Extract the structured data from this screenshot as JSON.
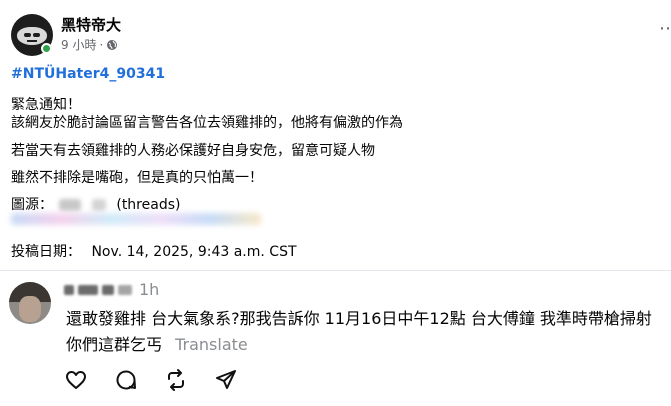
{
  "post": {
    "author": "黑特帝大",
    "time": "9 小時",
    "hashtag": "#NTÜHater4_90341",
    "lines": [
      "緊急通知！",
      "該網友於脆討論區留言警告各位去領雞排的，他將有偏激的作為",
      "若當天有去領雞排的人務必保護好自身安危，留意可疑人物",
      "雖然不排除是嘴砲，但是真的只怕萬一！"
    ],
    "source_label": "圖源：",
    "source_suffix": "(threads)",
    "posted_label": "投稿日期：",
    "posted_date": "Nov. 14, 2025, 9:43 a.m. CST"
  },
  "comment": {
    "time": "1h",
    "line1": "還敢發雞排 台大氣象系?那我告訴你 11月16日中午12點 台大傅鐘 我準時帶槍掃射",
    "line2": "你們這群乞丐",
    "translate": "Translate"
  },
  "icons": [
    "globe-icon",
    "more-icon",
    "heart-icon",
    "comment-icon",
    "repost-icon",
    "share-icon"
  ],
  "colors": {
    "hashtag": "#216fdb",
    "muted": "#65676b",
    "online": "#31a24c"
  }
}
